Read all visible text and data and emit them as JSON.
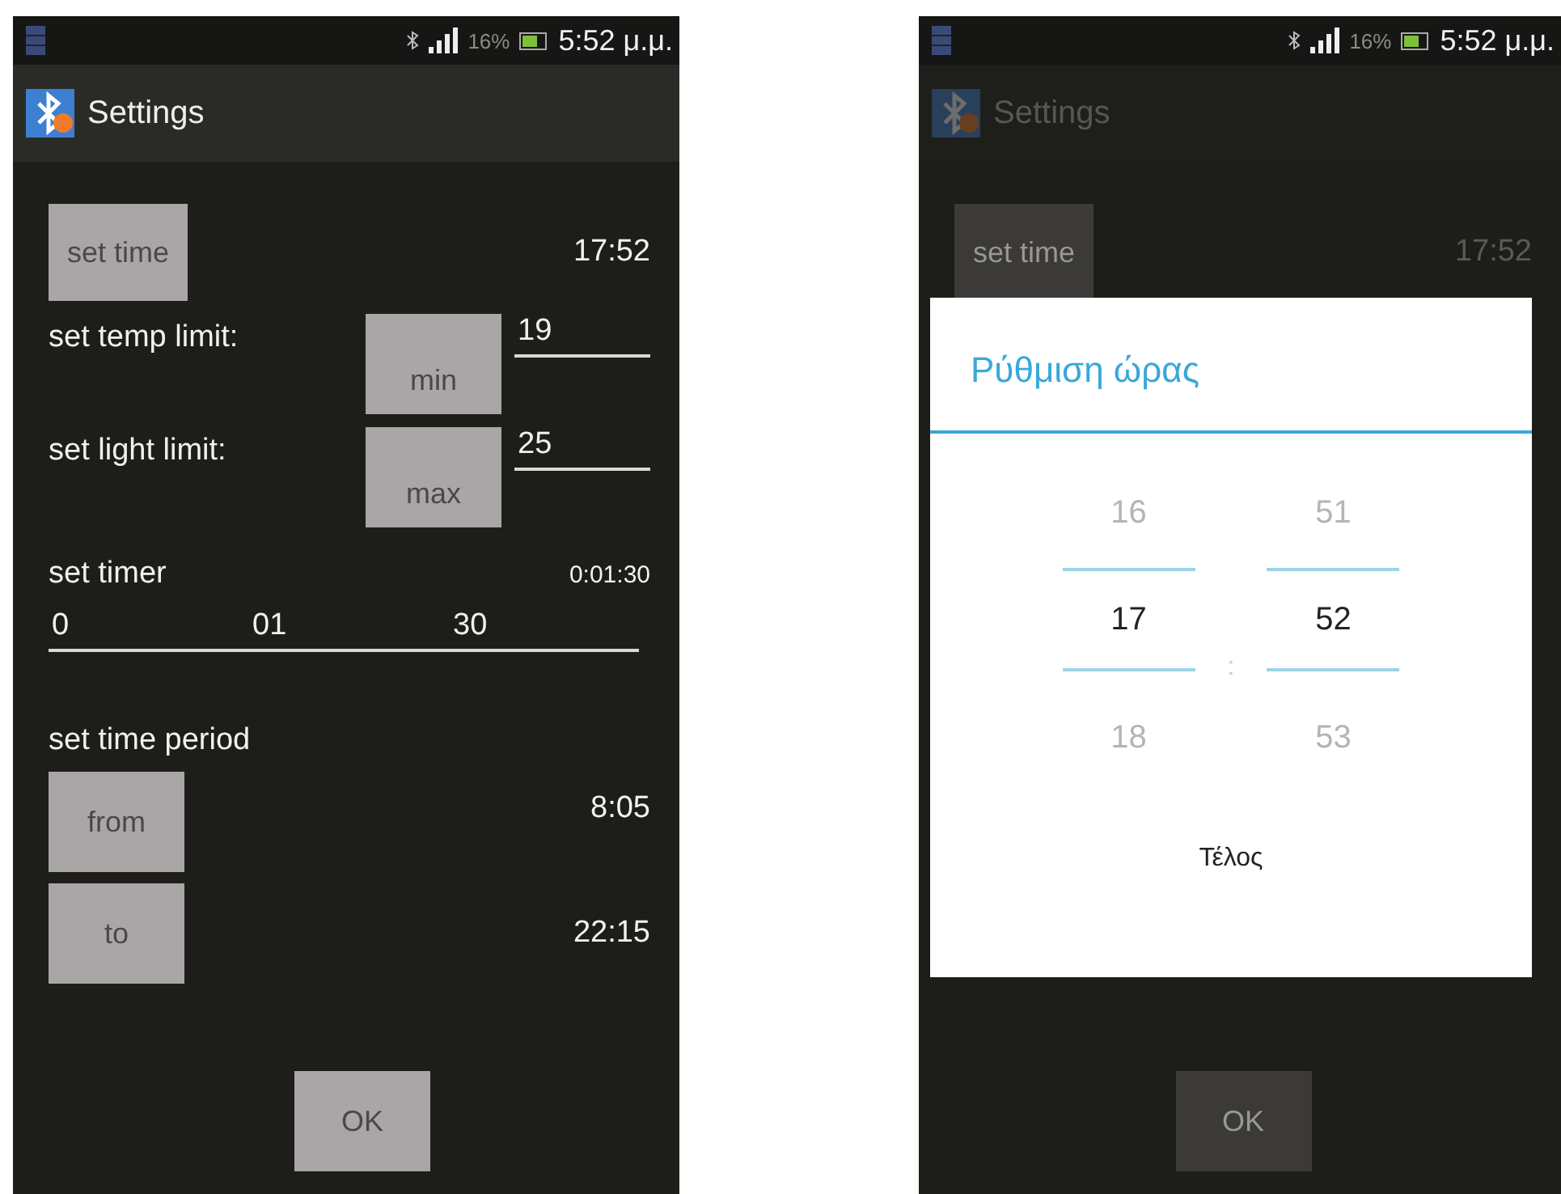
{
  "phones": [
    {
      "dimmed": false,
      "status_bar": {
        "battery": "16%",
        "time": "5:52 μ.μ."
      },
      "action_bar": {
        "title": "Settings"
      },
      "set_time": {
        "button": "set time",
        "value": "17:52"
      },
      "limits": [
        {
          "label": "set temp limit:",
          "button": "min",
          "value": "19"
        },
        {
          "label": "set light limit:",
          "button": "max",
          "value": "25"
        }
      ],
      "timer": {
        "label": "set timer",
        "reading": "0:01:30",
        "fields": [
          "0",
          "01",
          "30"
        ]
      },
      "period": {
        "label": "set time period",
        "rows": [
          {
            "button": "from",
            "value": "8:05"
          },
          {
            "button": "to",
            "value": "22:15"
          }
        ]
      },
      "ok_button": "OK"
    },
    {
      "dimmed": true,
      "status_bar": {
        "battery": "16%",
        "time": "5:52 μ.μ."
      },
      "action_bar": {
        "title": "Settings"
      },
      "set_time": {
        "button": "set time",
        "value": "17:52"
      },
      "dialog": {
        "title": "Ρύθμιση ώρας",
        "separator": ":",
        "columns": [
          {
            "above": "16",
            "current": "17",
            "below": "18"
          },
          {
            "above": "51",
            "current": "52",
            "below": "53"
          }
        ],
        "done": "Τέλος"
      },
      "ok_button": "OK"
    }
  ]
}
